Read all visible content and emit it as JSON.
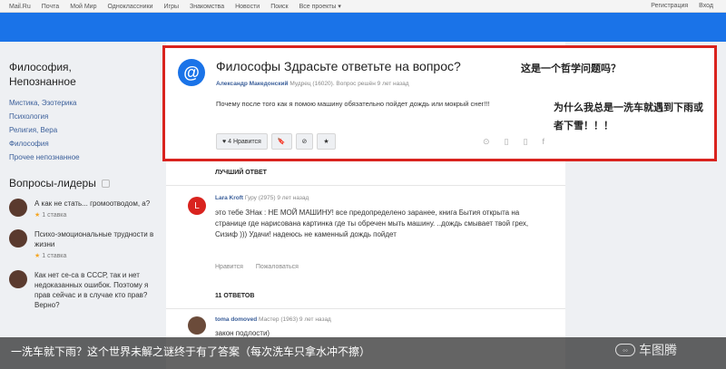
{
  "topnav": {
    "left": [
      "Mail.Ru",
      "Почта",
      "Мой Мир",
      "Одноклассники",
      "Игры",
      "Знакомства",
      "Новости",
      "Поиск",
      "Все проекты ▾"
    ],
    "right": [
      "Регистрация",
      "Вход"
    ]
  },
  "sidebar": {
    "category_title_1": "Философия,",
    "category_title_2": "Непознанное",
    "links": [
      "Мистика, Эзотерика",
      "Психология",
      "Религия, Вера",
      "Философия",
      "Прочее непознанное"
    ],
    "leaders_title": "Вопросы-лидеры",
    "leaders": [
      {
        "text": "А как не стать... громоотводом, а?",
        "votes": "1 ставка"
      },
      {
        "text": "Психо-эмоциональные трудности в жизни",
        "votes": "1 ставка"
      },
      {
        "text": "Как нет се-са в СССР, так и нет недоказанных ошибок. Поэтому я прав сейчас и в случае кто прав? Верно?",
        "votes": ""
      }
    ]
  },
  "question": {
    "icon_letter": "@",
    "title": "Философы Здрасьте ответьте на вопрос?",
    "author": "Александр Македонский",
    "meta": "Мудрец (16020). Вопрос решён 9 лет назад",
    "body": "Почему после того как я помою машину обязательно пойдет дождь или мокрый снег!!!",
    "actions": {
      "like": "♥ 4 Нравится",
      "bookmark": "🔖",
      "block": "⊘",
      "star": "★"
    },
    "small_icons": [
      "⊙",
      "▯",
      "▯",
      "f"
    ]
  },
  "notes": {
    "note1": "这是一个哲学问题吗？",
    "note2": "为什么我总是一洗车就遇到下雨或者下雪！！！"
  },
  "best_answer": {
    "label": "ЛУЧШИЙ ОТВЕТ",
    "avatar_letter": "L",
    "author": "Lara Kroft",
    "meta": "Гуру (2975) 9 лет назад",
    "body": "это тебе ЗНак : НЕ МОЙ МАШИНУ! все предопределено заранее, книга Бытия открыта на странице где нарисована картинка где ты обречен мыть машину. ..дождь смывает твой грех, Сизиф ))) Удачи! надеюсь не каменный дождь пойдет",
    "like": "Нравится",
    "complain": "Пожаловаться"
  },
  "answers_count": "11 ОТВЕТОВ",
  "answer2": {
    "author": "toma domoved",
    "meta": "Мастер (1963) 9 лет назад",
    "body": "закон подлости)"
  },
  "caption": "一洗车就下雨？这个世界未解之谜终于有了答案（每次洗车只拿水冲不擦）",
  "watermark": "车图腾",
  "colors": {
    "accent": "#1a73e8",
    "highlight": "#d9231e"
  }
}
